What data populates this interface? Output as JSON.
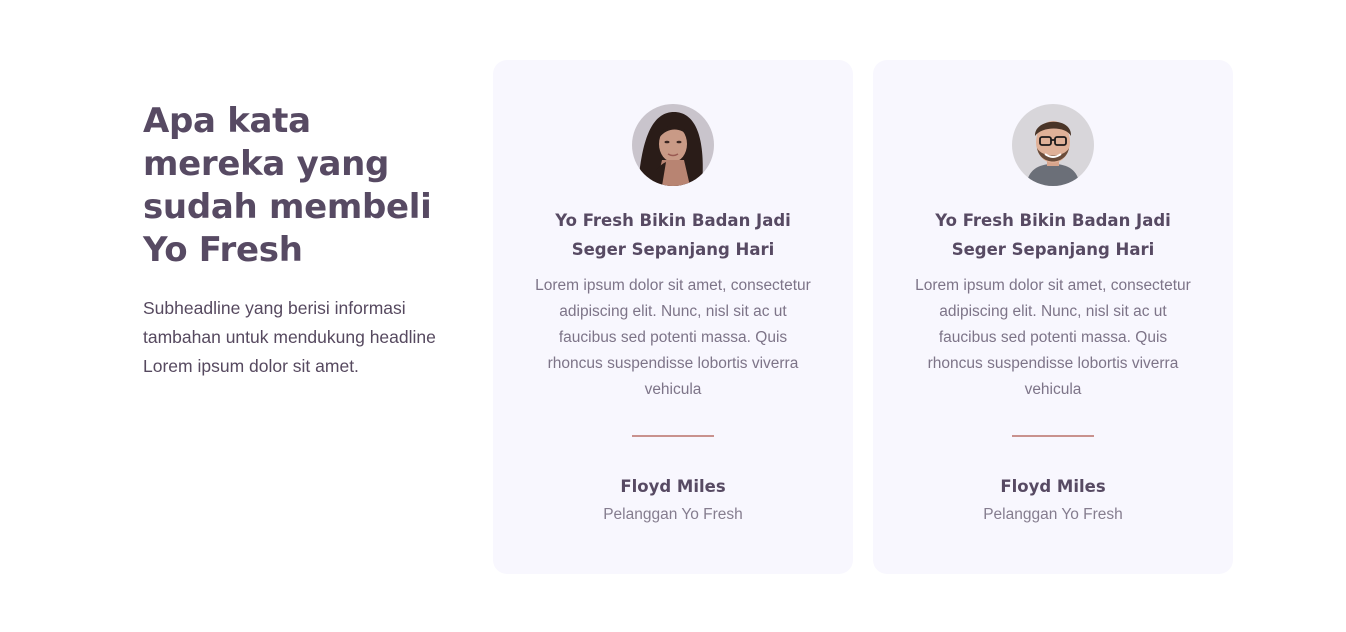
{
  "section": {
    "headline": "Apa kata mereka yang sudah membeli Yo Fresh",
    "subheadline": "Subheadline yang berisi informasi tambahan untuk mendukung headline Lorem ipsum dolor sit amet."
  },
  "testimonials": [
    {
      "avatar_icon": "woman-portrait",
      "title": "Yo Fresh Bikin Badan Jadi Seger Sepanjang Hari",
      "body": "Lorem ipsum dolor sit amet, consectetur adipiscing elit. Nunc, nisl sit ac ut faucibus sed potenti massa. Quis rhoncus suspendisse lobortis viverra vehicula",
      "name": "Floyd Miles",
      "role": "Pelanggan Yo Fresh"
    },
    {
      "avatar_icon": "man-portrait",
      "title": "Yo Fresh Bikin Badan Jadi Seger Sepanjang Hari",
      "body": "Lorem ipsum dolor sit amet, consectetur adipiscing elit. Nunc, nisl sit ac ut faucibus sed potenti massa. Quis rhoncus suspendisse lobortis viverra vehicula",
      "name": "Floyd Miles",
      "role": "Pelanggan Yo Fresh"
    }
  ],
  "colors": {
    "heading": "#574a63",
    "card_background": "#f8f7fe",
    "divider": "#c9928e",
    "muted_text": "#7d7488"
  }
}
